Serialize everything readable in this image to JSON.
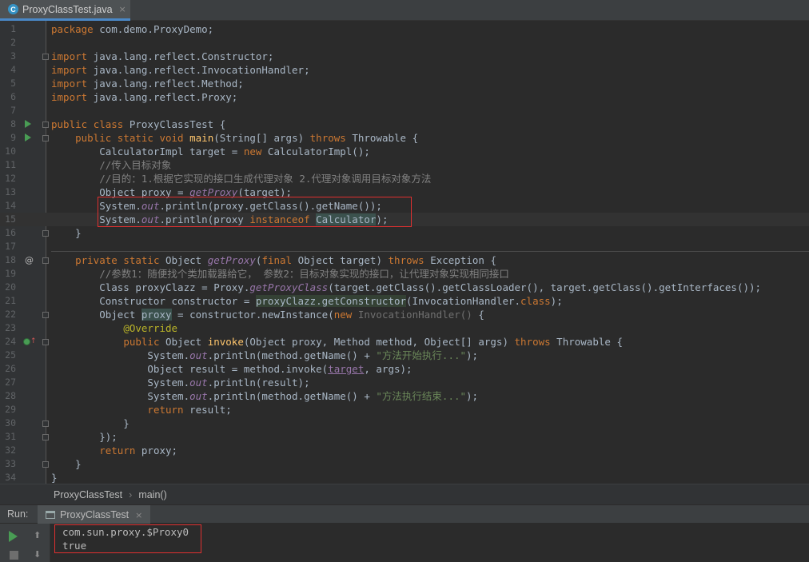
{
  "tab": {
    "icon": "C",
    "label": "ProxyClassTest.java",
    "close": "×"
  },
  "editor": {
    "lines": [
      {
        "n": "1",
        "t": "package com.demo.ProxyDemo;"
      },
      {
        "n": "2",
        "t": ""
      },
      {
        "n": "3",
        "t": "import java.lang.reflect.Constructor;"
      },
      {
        "n": "4",
        "t": "import java.lang.reflect.InvocationHandler;"
      },
      {
        "n": "5",
        "t": "import java.lang.reflect.Method;"
      },
      {
        "n": "6",
        "t": "import java.lang.reflect.Proxy;"
      },
      {
        "n": "7",
        "t": ""
      },
      {
        "n": "8",
        "t": "public class ProxyClassTest {"
      },
      {
        "n": "9",
        "t": "    public static void main(String[] args) throws Throwable {"
      },
      {
        "n": "10",
        "t": "        CalculatorImpl target = new CalculatorImpl();"
      },
      {
        "n": "11",
        "t": "        //传入目标对象"
      },
      {
        "n": "12",
        "t": "        //目的：1.根据它实现的接口生成代理对象 2.代理对象调用目标对象方法"
      },
      {
        "n": "13",
        "t": "        Object proxy = getProxy(target);"
      },
      {
        "n": "14",
        "t": "        System.out.println(proxy.getClass().getName());"
      },
      {
        "n": "15",
        "t": "        System.out.println(proxy instanceof Calculator);"
      },
      {
        "n": "16",
        "t": "    }"
      },
      {
        "n": "17",
        "t": ""
      },
      {
        "n": "18",
        "t": "    private static Object getProxy(final Object target) throws Exception {"
      },
      {
        "n": "19",
        "t": "        //参数1：随便找个类加载器给它， 参数2：目标对象实现的接口，让代理对象实现相同接口"
      },
      {
        "n": "20",
        "t": "        Class proxyClazz = Proxy.getProxyClass(target.getClass().getClassLoader(), target.getClass().getInterfaces());"
      },
      {
        "n": "21",
        "t": "        Constructor constructor = proxyClazz.getConstructor(InvocationHandler.class);"
      },
      {
        "n": "22",
        "t": "        Object proxy = constructor.newInstance(new InvocationHandler() {"
      },
      {
        "n": "23",
        "t": "            @Override"
      },
      {
        "n": "24",
        "t": "            public Object invoke(Object proxy, Method method, Object[] args) throws Throwable {"
      },
      {
        "n": "25",
        "t": "                System.out.println(method.getName() + \"方法开始执行...\");"
      },
      {
        "n": "26",
        "t": "                Object result = method.invoke(target, args);"
      },
      {
        "n": "27",
        "t": "                System.out.println(result);"
      },
      {
        "n": "28",
        "t": "                System.out.println(method.getName() + \"方法执行结束...\");"
      },
      {
        "n": "29",
        "t": "                return result;"
      },
      {
        "n": "30",
        "t": "            }"
      },
      {
        "n": "31",
        "t": "        });"
      },
      {
        "n": "32",
        "t": "        return proxy;"
      },
      {
        "n": "33",
        "t": "    }"
      },
      {
        "n": "34",
        "t": "}"
      }
    ]
  },
  "breadcrumb": {
    "class_name": "ProxyClassTest",
    "separator": "›",
    "method": "main()"
  },
  "run": {
    "title": "Run:",
    "tab_label": "ProxyClassTest",
    "close": "×",
    "up_arrow": "⬆",
    "down_arrow": "⬇"
  },
  "console": {
    "lines": [
      "com.sun.proxy.$Proxy0",
      "true"
    ]
  },
  "colors": {
    "keyword": "#cc7832",
    "method": "#ffc66d",
    "string": "#6a8759",
    "comment": "#808080",
    "field": "#9876aa",
    "highlight_box": "#e03030"
  }
}
